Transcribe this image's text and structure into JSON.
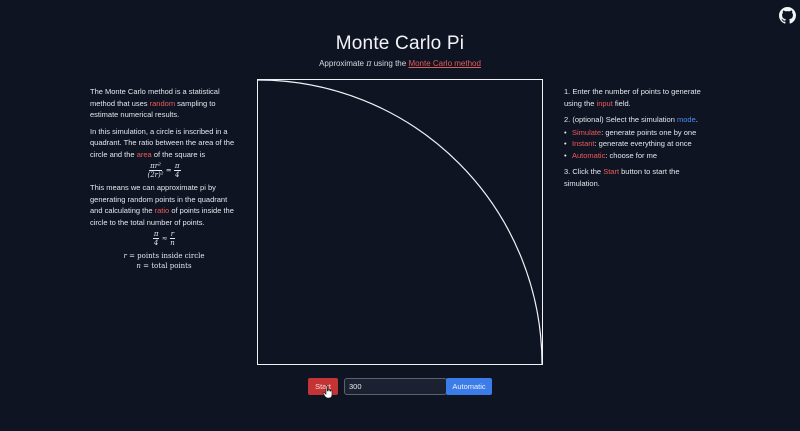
{
  "header": {
    "title": "Monte Carlo Pi",
    "subtitle_prefix": "Approximate",
    "subtitle_symbol": "π",
    "subtitle_middle": "using the",
    "subtitle_link": "Monte Carlo method"
  },
  "github_icon": "github-icon",
  "left": {
    "p1_a": "The Monte Carlo method is a statistical method that uses",
    "p1_hl": "random",
    "p1_b": "sampling to estimate numerical results.",
    "p2_a": "In this simulation, a circle is inscribed in a quadrant. The ratio between the area of the circle and the",
    "p2_hl": "area",
    "p2_b": "of the square is",
    "eq1_num": "πr²",
    "eq1_den": "(2r)²",
    "eq1_eq": "=",
    "eq1_rnum": "π",
    "eq1_rden": "4",
    "p3_a": "This means we can approximate pi by generating random points in the quadrant and calculating the",
    "p3_hl": "ratio",
    "p3_b": "of points inside the circle to the total number of points.",
    "eq2_lnum": "π",
    "eq2_lden": "4",
    "eq2_op": "≈",
    "eq2_rnum": "r",
    "eq2_rden": "n",
    "def_r_var": "r",
    "def_r_text": "= points inside circle",
    "def_n_var": "n",
    "def_n_text": "= total points"
  },
  "right": {
    "s1_a": "1. Enter the number of points to generate using the",
    "s1_hl": "input",
    "s1_b": "field.",
    "s2_a": "2. (optional) Select the simulation",
    "s2_hl": "mode",
    "s2_b": ".",
    "modes": [
      {
        "name": "Simulate",
        "desc": ": generate points one by one"
      },
      {
        "name": "Instant",
        "desc": ": generate everything at once"
      },
      {
        "name": "Automatic",
        "desc": ": choose for me"
      }
    ],
    "s3_a": "3. Click the",
    "s3_hl": "Start",
    "s3_b": "button to start the simulation."
  },
  "controls": {
    "start_label": "Start",
    "points_value": "300",
    "mode_label": "Automatic"
  },
  "colors": {
    "background": "#0f1422",
    "highlight_red": "#ef5a5a",
    "highlight_blue": "#4a8cf5",
    "start_button": "#c43434",
    "mode_button": "#3b7ce8"
  }
}
